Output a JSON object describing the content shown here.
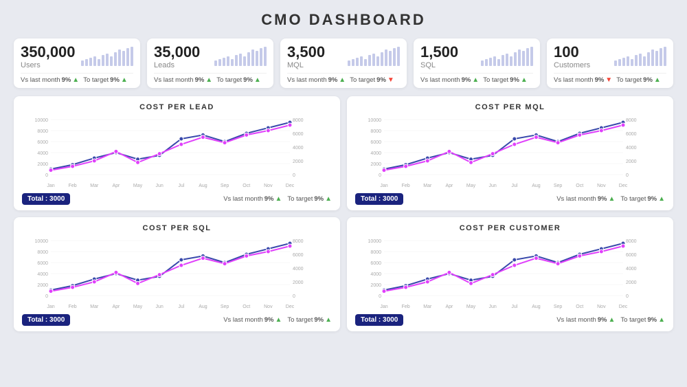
{
  "title": "CMO DASHBOARD",
  "kpis": [
    {
      "id": "users",
      "number": "350,000",
      "label": "Users",
      "sparkHeights": [
        8,
        10,
        12,
        14,
        10,
        16,
        18,
        14,
        20,
        24,
        22,
        26,
        28
      ],
      "vsLastMonth": "9%",
      "vsLastMonthDir": "up",
      "toTarget": "9%",
      "toTargetDir": "up"
    },
    {
      "id": "leads",
      "number": "35,000",
      "label": "Leads",
      "sparkHeights": [
        8,
        10,
        12,
        14,
        10,
        16,
        18,
        14,
        20,
        24,
        22,
        26,
        28
      ],
      "vsLastMonth": "9%",
      "vsLastMonthDir": "up",
      "toTarget": "9%",
      "toTargetDir": "up"
    },
    {
      "id": "mql",
      "number": "3,500",
      "label": "MQL",
      "sparkHeights": [
        8,
        10,
        12,
        14,
        10,
        16,
        18,
        14,
        20,
        24,
        22,
        26,
        28
      ],
      "vsLastMonth": "9%",
      "vsLastMonthDir": "up",
      "toTarget": "9%",
      "toTargetDir": "down"
    },
    {
      "id": "sql",
      "number": "1,500",
      "label": "SQL",
      "sparkHeights": [
        8,
        10,
        12,
        14,
        10,
        16,
        18,
        14,
        20,
        24,
        22,
        26,
        28
      ],
      "vsLastMonth": "9%",
      "vsLastMonthDir": "up",
      "toTarget": "9%",
      "toTargetDir": "up"
    },
    {
      "id": "customers",
      "number": "100",
      "label": "Customers",
      "sparkHeights": [
        8,
        10,
        12,
        14,
        10,
        16,
        18,
        14,
        20,
        24,
        22,
        26,
        28
      ],
      "vsLastMonth": "9%",
      "vsLastMonthDir": "down",
      "toTarget": "9%",
      "toTargetDir": "up"
    }
  ],
  "charts": [
    {
      "id": "cost-per-lead",
      "title": "COST PER LEAD",
      "total": "Total : 3000",
      "vsLastMonth": "9%",
      "vsLastMonthDir": "up",
      "toTarget": "9%",
      "toTargetDir": "up",
      "leftAxis": [
        "10000",
        "8000",
        "6000",
        "4000",
        "2000",
        "0"
      ],
      "rightAxis": [
        "8000",
        "6000",
        "4000",
        "2000",
        "0"
      ],
      "months": [
        "Jan",
        "Feb",
        "Mar",
        "Apr",
        "May",
        "Jun",
        "Jul",
        "Aug",
        "Sep",
        "Oct",
        "Nov",
        "Dec"
      ],
      "series1": [
        10,
        18,
        30,
        40,
        28,
        35,
        65,
        72,
        60,
        75,
        85,
        95
      ],
      "series2": [
        8,
        15,
        25,
        42,
        22,
        38,
        55,
        68,
        58,
        72,
        80,
        90
      ]
    },
    {
      "id": "cost-per-mql",
      "title": "COST PER MQL",
      "total": "Total : 3000",
      "vsLastMonth": "9%",
      "vsLastMonthDir": "up",
      "toTarget": "9%",
      "toTargetDir": "up",
      "leftAxis": [
        "10000",
        "8000",
        "6000",
        "4000",
        "2000",
        "0"
      ],
      "rightAxis": [
        "8000",
        "6000",
        "4000",
        "2000",
        "0"
      ],
      "months": [
        "Jan",
        "Feb",
        "Mar",
        "Apr",
        "May",
        "Jun",
        "Jul",
        "Aug",
        "Sep",
        "Oct",
        "Nov",
        "Dec"
      ],
      "series1": [
        10,
        18,
        30,
        40,
        28,
        35,
        65,
        72,
        60,
        75,
        85,
        95
      ],
      "series2": [
        8,
        15,
        25,
        42,
        22,
        38,
        55,
        68,
        58,
        72,
        80,
        90
      ]
    },
    {
      "id": "cost-per-sql",
      "title": "COST PER SQL",
      "total": "Total : 3000",
      "vsLastMonth": "9%",
      "vsLastMonthDir": "up",
      "toTarget": "9%",
      "toTargetDir": "up",
      "leftAxis": [
        "10000",
        "8000",
        "6000",
        "4000",
        "2000",
        "0"
      ],
      "rightAxis": [
        "8000",
        "6000",
        "4000",
        "2000",
        "0"
      ],
      "months": [
        "Jan",
        "Feb",
        "Mar",
        "Apr",
        "May",
        "Jun",
        "Jul",
        "Aug",
        "Sep",
        "Oct",
        "Nov",
        "Dec"
      ],
      "series1": [
        10,
        18,
        30,
        40,
        28,
        35,
        65,
        72,
        60,
        75,
        85,
        95
      ],
      "series2": [
        8,
        15,
        25,
        42,
        22,
        38,
        55,
        68,
        58,
        72,
        80,
        90
      ]
    },
    {
      "id": "cost-per-customer",
      "title": "COST PER CUSTOMER",
      "total": "Total : 3000",
      "vsLastMonth": "9%",
      "vsLastMonthDir": "up",
      "toTarget": "9%",
      "toTargetDir": "up",
      "leftAxis": [
        "10000",
        "8000",
        "6000",
        "4000",
        "2000",
        "0"
      ],
      "rightAxis": [
        "8000",
        "6000",
        "4000",
        "2000",
        "0"
      ],
      "months": [
        "Jan",
        "Feb",
        "Mar",
        "Apr",
        "May",
        "Jun",
        "Jul",
        "Aug",
        "Sep",
        "Oct",
        "Nov",
        "Dec"
      ],
      "series1": [
        10,
        18,
        30,
        40,
        28,
        35,
        65,
        72,
        60,
        75,
        85,
        95
      ],
      "series2": [
        8,
        15,
        25,
        42,
        22,
        38,
        55,
        68,
        58,
        72,
        80,
        90
      ]
    }
  ],
  "labels": {
    "vsLastMonth": "Vs last month",
    "toTarget": "To target"
  },
  "colors": {
    "accent": "#1a237e",
    "series1": "#3949ab",
    "series2": "#e040fb",
    "arrowUp": "#4caf50",
    "arrowDown": "#f44336"
  }
}
